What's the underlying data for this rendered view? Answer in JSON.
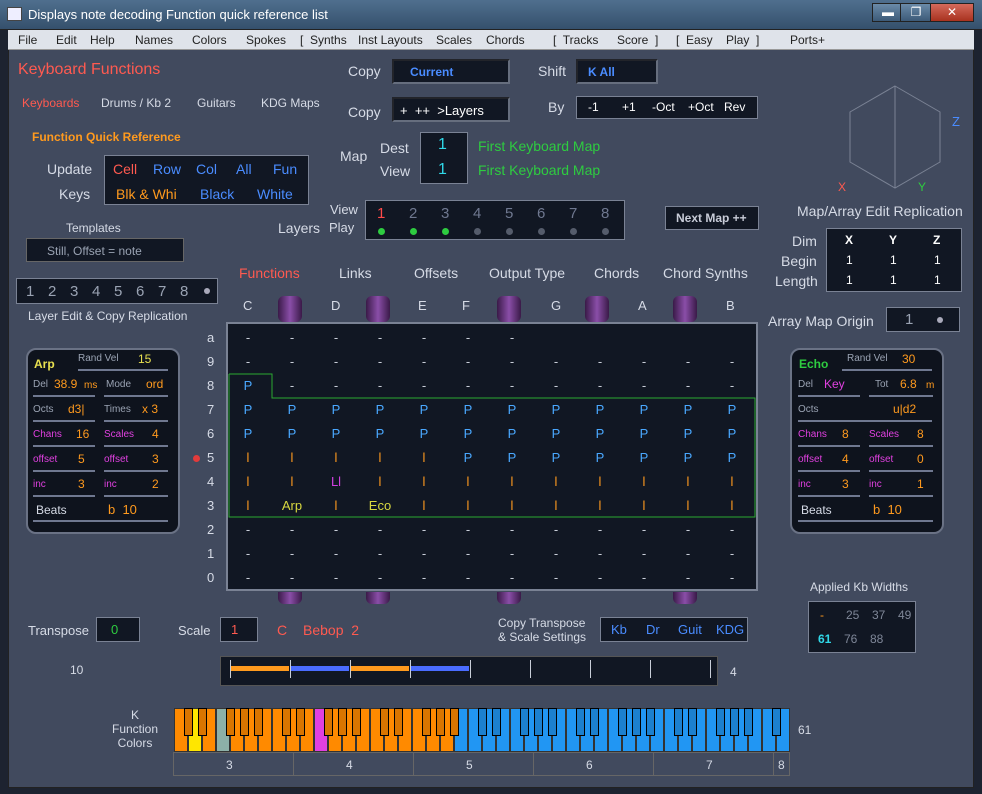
{
  "window": {
    "title": "Displays note decoding Function quick reference list",
    "min": "▬",
    "max": "❐",
    "close": "✕"
  },
  "menu": [
    "File",
    "Edit",
    "Help",
    "Names",
    "Colors",
    "Spokes",
    "[  Synths",
    "Inst Layouts",
    "Scales",
    "Chords",
    "[  Tracks",
    "Score  ]",
    "[  Easy",
    "Play  ]",
    "Ports+"
  ],
  "header": {
    "keyboard_functions": "Keyboard  Functions",
    "copy": "Copy",
    "copy_value": "Current",
    "copy2": "Copy",
    "copy2_value": "+  ++  >Layers",
    "shift": "Shift",
    "shift_value": "K  All",
    "by": "By",
    "by_values": [
      "-1",
      "+1",
      "-Oct",
      "+Oct",
      "Rev"
    ]
  },
  "tabs": [
    "Keyboards",
    "Drums / Kb 2",
    "Guitars",
    "KDG Maps"
  ],
  "fqr": {
    "title": "Function Quick Reference",
    "update": "Update",
    "keys": "Keys",
    "row1": [
      "Cell",
      "Row",
      "Col",
      "All",
      "Fun"
    ],
    "row2": [
      "Blk & Whi",
      "Black",
      "White"
    ]
  },
  "map": {
    "label": "Map",
    "dest": "Dest",
    "view": "View",
    "dest_val": "1",
    "view_val": "1",
    "dest_name": "First Keyboard Map",
    "view_name": "First Keyboard Map"
  },
  "layers": {
    "label": "Layers",
    "view": "View",
    "play": "Play",
    "numbers": [
      "1",
      "2",
      "3",
      "4",
      "5",
      "6",
      "7",
      "8"
    ],
    "play_on": [
      true,
      true,
      true,
      false,
      false,
      false,
      false,
      false
    ]
  },
  "next_map": "Next Map ++",
  "templates": {
    "title": "Templates",
    "value": "Still, Offset = note"
  },
  "layer_edit": {
    "numbers": [
      "1",
      "2",
      "3",
      "4",
      "5",
      "6",
      "7",
      "8"
    ],
    "caption": "Layer Edit & Copy Replication"
  },
  "axes": {
    "x": "X",
    "y": "Y",
    "z": "Z",
    "caption": "Map/Array Edit Replication"
  },
  "dims": {
    "dim": "Dim",
    "begin": "Begin",
    "length": "Length",
    "cols": [
      "X",
      "Y",
      "Z"
    ],
    "begin_vals": [
      "1",
      "1",
      "1"
    ],
    "length_vals": [
      "1",
      "1",
      "1"
    ]
  },
  "array_origin": {
    "label": "Array Map Origin",
    "value": "1"
  },
  "grid_tabs": [
    "Functions",
    "Links",
    "Offsets",
    "Output Type",
    "Chords",
    "Chord Synths"
  ],
  "notes": [
    "C",
    "D",
    "E",
    "F",
    "G",
    "A",
    "B"
  ],
  "rows": [
    {
      "label": "a",
      "cells": [
        "-",
        "-",
        "-",
        "-",
        "-",
        "-",
        "-",
        "",
        "",
        "",
        "",
        ""
      ]
    },
    {
      "label": "9",
      "cells": [
        "-",
        "-",
        "-",
        "-",
        "-",
        "-",
        "-",
        "-",
        "-",
        "-",
        "-",
        "-"
      ]
    },
    {
      "label": "8",
      "cells": [
        "P",
        "-",
        "-",
        "-",
        "-",
        "-",
        "-",
        "-",
        "-",
        "-",
        "-",
        "-"
      ]
    },
    {
      "label": "7",
      "cells": [
        "P",
        "P",
        "P",
        "P",
        "P",
        "P",
        "P",
        "P",
        "P",
        "P",
        "P",
        "P"
      ]
    },
    {
      "label": "6",
      "cells": [
        "P",
        "P",
        "P",
        "P",
        "P",
        "P",
        "P",
        "P",
        "P",
        "P",
        "P",
        "P"
      ]
    },
    {
      "label": "5",
      "cells": [
        "l",
        "l",
        "l",
        "l",
        "l",
        "P",
        "P",
        "P",
        "P",
        "P",
        "P",
        "P"
      ]
    },
    {
      "label": "4",
      "cells": [
        "l",
        "l",
        "Ll",
        "l",
        "l",
        "l",
        "l",
        "l",
        "l",
        "l",
        "l",
        "l"
      ]
    },
    {
      "label": "3",
      "cells": [
        "l",
        "Arp",
        "l",
        "Eco",
        "l",
        "l",
        "l",
        "l",
        "l",
        "l",
        "l",
        "l"
      ]
    },
    {
      "label": "2",
      "cells": [
        "-",
        "-",
        "-",
        "-",
        "-",
        "-",
        "-",
        "-",
        "-",
        "-",
        "-",
        "-"
      ]
    },
    {
      "label": "1",
      "cells": [
        "-",
        "-",
        "-",
        "-",
        "-",
        "-",
        "-",
        "-",
        "-",
        "-",
        "-",
        "-"
      ]
    },
    {
      "label": "0",
      "cells": [
        "-",
        "-",
        "-",
        "-",
        "-",
        "-",
        "-",
        "-",
        "-",
        "-",
        "-",
        "-"
      ]
    }
  ],
  "arp": {
    "title": "Arp",
    "rand_vel": "Rand Vel",
    "rand_val": "15",
    "del": "Del",
    "del_val": "38.9",
    "del_unit": "ms",
    "mode": "Mode",
    "mode_val": "ord",
    "octs": "Octs",
    "octs_val": "d3|",
    "times": "Times",
    "times_val": "x 3",
    "chans": "Chans",
    "chans_val": "16",
    "scales": "Scales",
    "scales_val": "4",
    "offset": "offset",
    "offset_val": "5",
    "offset2_val": "3",
    "inc": "inc",
    "inc_val": "3",
    "inc2_val": "2",
    "beats": "Beats",
    "beats_val": "b  10"
  },
  "echo": {
    "title": "Echo",
    "rand_vel": "Rand Vel",
    "rand_val": "30",
    "del": "Del",
    "del_val": "Key",
    "tot": "Tot",
    "tot_val": "6.8",
    "tot_unit": "m",
    "octs": "Octs",
    "octs_val": "u|d2",
    "chans": "Chans",
    "chans_val": "8",
    "scales": "Scales",
    "scales_val": "8",
    "offset": "offset",
    "offset_val": "4",
    "offset2_val": "0",
    "inc": "inc",
    "inc_val": "3",
    "inc2_val": "1",
    "beats": "Beats",
    "beats_val": "b  10"
  },
  "applied": {
    "title": "Applied Kb Widths",
    "row1": [
      "-",
      "25",
      "37",
      "49"
    ],
    "row2": [
      "61",
      "76",
      "88"
    ]
  },
  "transpose": {
    "label": "Transpose",
    "value": "0",
    "scale": "Scale",
    "scale_val": "1",
    "key": "C",
    "scale_name": "Bebop  2",
    "copy_caption": "Copy Transpose\n& Scale Settings",
    "copy_btns": [
      "Kb",
      "Dr",
      "Guit",
      "KDG"
    ]
  },
  "range": {
    "left": "10",
    "right": "4"
  },
  "kfc": {
    "label": "K\nFunction\nColors",
    "count": "61",
    "octaves": [
      "3",
      "4",
      "5",
      "6",
      "7",
      "8"
    ]
  }
}
